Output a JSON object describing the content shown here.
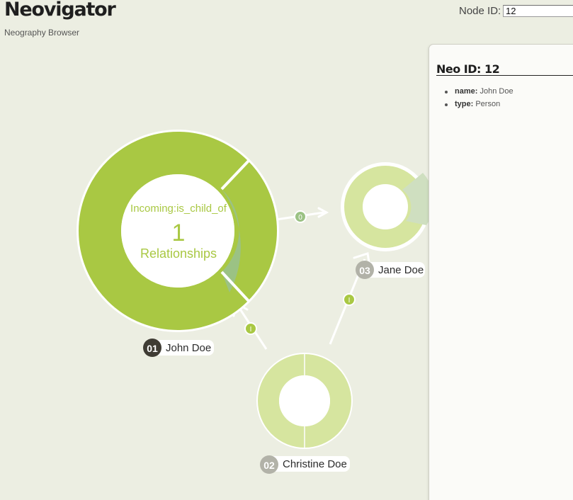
{
  "app": {
    "title": "Neovigator",
    "subtitle": "Neography Browser"
  },
  "search": {
    "label": "Node ID:",
    "value": "12"
  },
  "graph": {
    "center_node": {
      "rel_direction_label": "Incoming:is_child_of",
      "rel_count": "1",
      "rel_label": "Relationships",
      "badge": "01",
      "name": "John Doe"
    },
    "nodes": [
      {
        "badge": "02",
        "name": "Christine Doe"
      },
      {
        "badge": "03",
        "name": "Jane Doe"
      }
    ],
    "edges": [
      {
        "label": "0"
      },
      {
        "label": "I"
      },
      {
        "label": "I"
      }
    ],
    "colors": {
      "primary_green": "#a9c843",
      "muted_green": "#9bc284",
      "pale_green": "#d6e59f",
      "pale_sage": "#cfdfc0",
      "dark_badge": "#3f3c34",
      "grey_badge": "#b2b2a8"
    }
  },
  "details": {
    "title": "Neo ID: 12",
    "properties": [
      {
        "key": "name:",
        "value": "John Doe"
      },
      {
        "key": "type:",
        "value": "Person"
      }
    ]
  }
}
